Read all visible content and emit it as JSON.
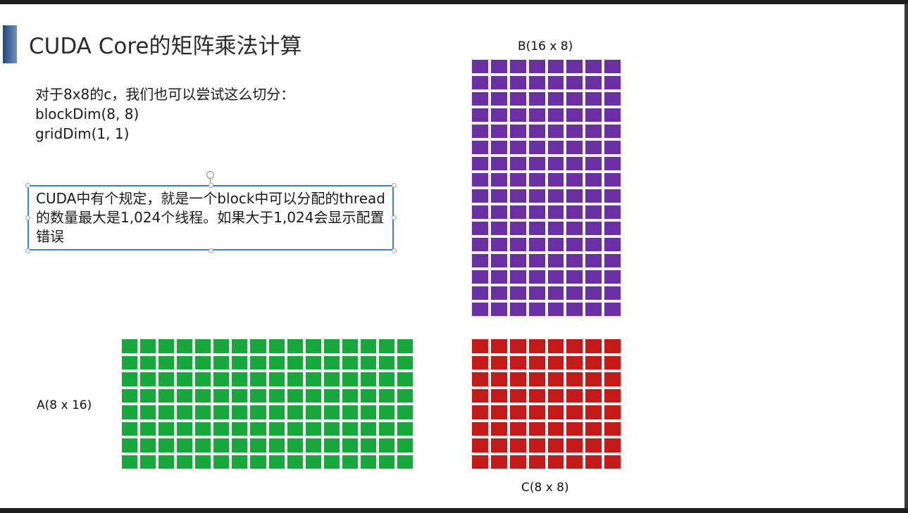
{
  "slide": {
    "title": "CUDA Core的矩阵乘法计算",
    "intro_lines": [
      "对于8x8的c，我们也可以尝试这么切分：",
      "blockDim(8, 8)",
      "gridDim(1, 1)"
    ],
    "callout": "CUDA中有个规定，就是一个block中可以分配的thread的数量最大是1,024个线程。如果大于1,024会显示配置错误"
  },
  "matrices": {
    "b": {
      "label": "B(16 x 8)",
      "rows": 16,
      "cols": 8,
      "color": "#6a2fa3"
    },
    "a": {
      "label": "A(8 x 16)",
      "rows": 8,
      "cols": 16,
      "color": "#16a83a"
    },
    "c": {
      "label": "C(8 x 8)",
      "rows": 8,
      "cols": 8,
      "color": "#c41a1a"
    }
  },
  "colors": {
    "accent_bar": "#24467a",
    "selection_border": "#3d7de6"
  }
}
